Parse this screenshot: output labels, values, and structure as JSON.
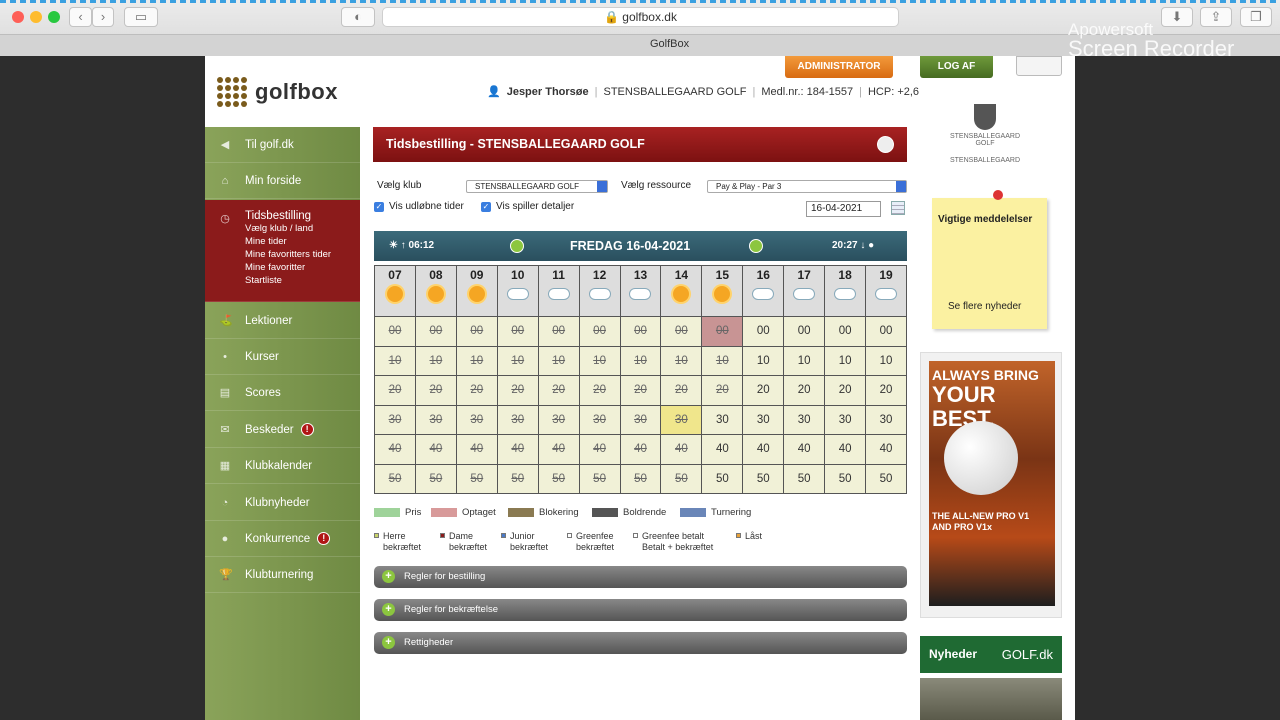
{
  "browser": {
    "url": "golfbox.dk",
    "tab_title": "GolfBox"
  },
  "watermark": {
    "line1": "Apowersoft",
    "line2": "Screen Recorder"
  },
  "header": {
    "logo": "golfbox",
    "user": "Jesper Thorsøe",
    "club": "STENSBALLEGAARD GOLF",
    "member": "Medl.nr.: 184-1557",
    "hcp": "HCP: +2,6",
    "admin": "ADMINISTRATOR",
    "logout": "LOG AF"
  },
  "sidebar": {
    "items": [
      {
        "label": "Til golf.dk"
      },
      {
        "label": "Min forside"
      },
      {
        "label": "Tidsbestilling",
        "sub": [
          "Vælg klub / land",
          "Mine tider",
          "Mine favoritters tider",
          "Mine favoritter",
          "Startliste"
        ]
      },
      {
        "label": "Lektioner"
      },
      {
        "label": "Kurser"
      },
      {
        "label": "Scores"
      },
      {
        "label": "Beskeder",
        "badge": "!"
      },
      {
        "label": "Klubkalender"
      },
      {
        "label": "Klubnyheder"
      },
      {
        "label": "Konkurrence",
        "badge": "!"
      },
      {
        "label": "Klubturnering"
      }
    ]
  },
  "main": {
    "title": "Tidsbestilling - STENSBALLEGAARD GOLF",
    "club_label": "Vælg klub",
    "club_value": "STENSBALLEGAARD GOLF",
    "resource_label": "Vælg ressource",
    "resource_value": "Pay & Play - Par 3",
    "show_expired": "Vis udløbne tider",
    "show_details": "Vis spiller detaljer",
    "date": "16-04-2021"
  },
  "day": {
    "sunrise": "06:12",
    "date": "FREDAG 16-04-2021",
    "sunset": "20:27"
  },
  "grid": {
    "hours": [
      "07",
      "08",
      "09",
      "10",
      "11",
      "12",
      "13",
      "14",
      "15",
      "16",
      "17",
      "18",
      "19"
    ],
    "weather": [
      "sun",
      "sun",
      "sun-cloud",
      "cloud",
      "cloud",
      "cloud",
      "cloud",
      "sun",
      "sun-cloud",
      "cloud",
      "cloud",
      "cloud",
      "cloud"
    ],
    "minutes": [
      "00",
      "10",
      "20",
      "30",
      "40",
      "50"
    ]
  },
  "legend": {
    "row1": [
      "Pris",
      "Optaget",
      "Blokering",
      "Boldrende",
      "Turnering"
    ],
    "row1_colors": [
      "#9fd39a",
      "#d89a9a",
      "#8a7a52",
      "#555555",
      "#6a86b8"
    ],
    "row2": [
      [
        "Herre",
        "bekræftet"
      ],
      [
        "Dame",
        "bekræftet"
      ],
      [
        "Junior",
        "bekræftet"
      ],
      [
        "Greenfee",
        "bekræftet"
      ],
      [
        "Greenfee betalt",
        "Betalt + bekræftet"
      ],
      [
        "Låst",
        ""
      ]
    ]
  },
  "accordions": [
    "Regler for bestilling",
    "Regler for bekræftelse",
    "Rettigheder"
  ],
  "right": {
    "club_name": "STENSBALLEGAARD GOLF",
    "club_caption": "STENSBALLEGAARD",
    "note_title": "Vigtige meddelelser",
    "note_more": "Se flere nyheder",
    "ad_line1": "ALWAYS BRING",
    "ad_line2": "YOUR BEST.",
    "ad_line3": "THE ALL-NEW PRO V1",
    "ad_line4": "AND PRO V1x",
    "news_title": "Nyheder",
    "news_brand": "GOLF.dk"
  }
}
